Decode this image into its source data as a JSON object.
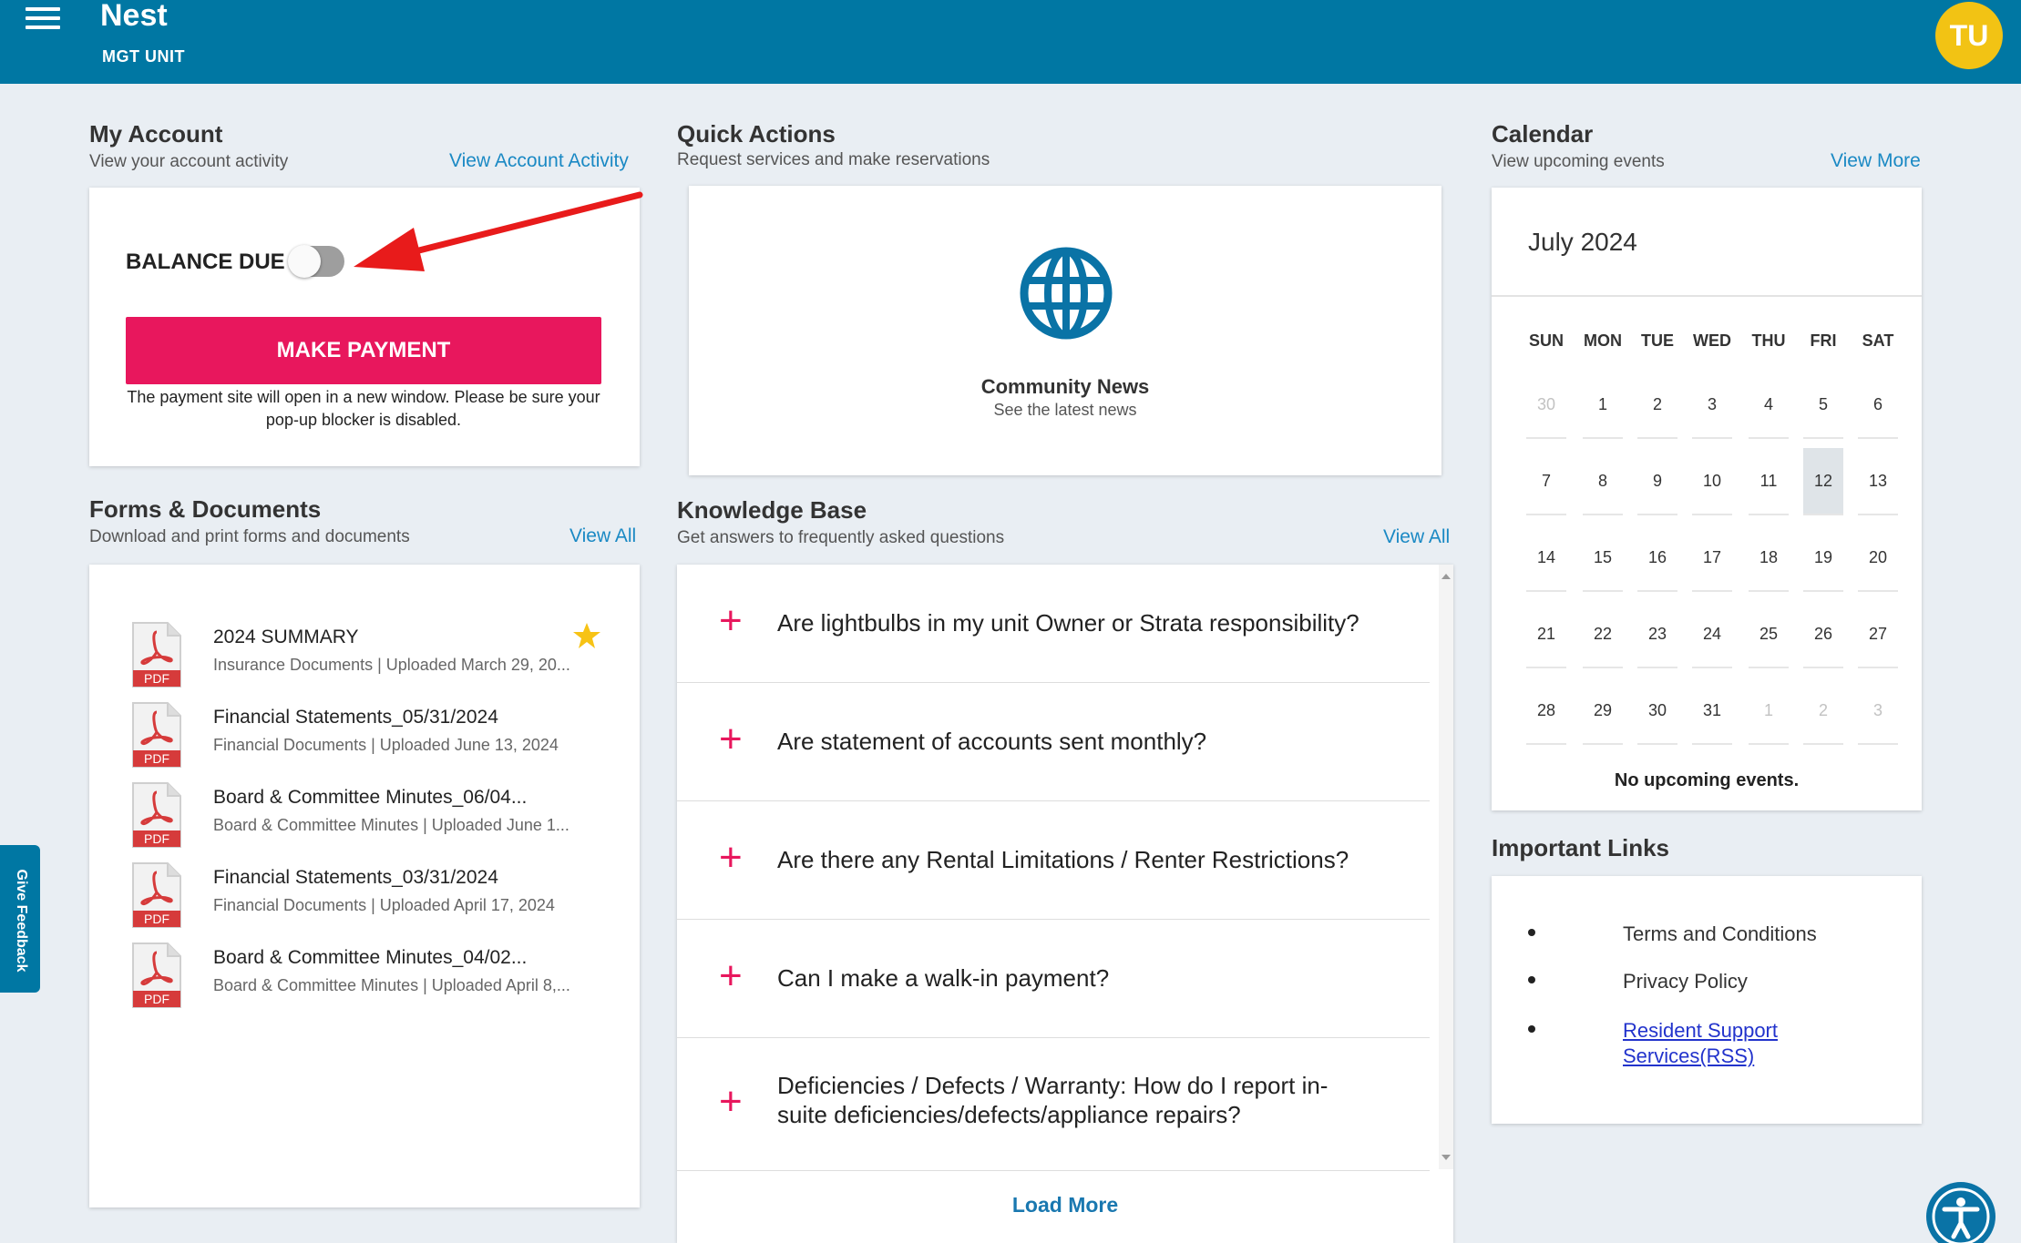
{
  "header": {
    "title": "Nest",
    "subtitle": "MGT UNIT",
    "avatar_initials": "TU",
    "bar_color": "#0077a3",
    "avatar_color": "#f2c314"
  },
  "account": {
    "title": "My Account",
    "subtitle": "View your account activity",
    "link": "View Account Activity",
    "balance_label": "BALANCE DUE",
    "toggle_on": false,
    "pay_button": "MAKE PAYMENT",
    "pay_note": "The payment site will open in a new window. Please be sure your pop-up blocker is disabled.",
    "accent": "#e8175d"
  },
  "quick_actions": {
    "title": "Quick Actions",
    "subtitle": "Request services and make reservations",
    "items": [
      {
        "icon": "globe-icon",
        "title": "Community News",
        "subtitle": "See the latest news"
      }
    ]
  },
  "forms": {
    "title": "Forms & Documents",
    "subtitle": "Download and print forms and documents",
    "link": "View All",
    "file_type": "PDF",
    "documents": [
      {
        "name": "2024 SUMMARY",
        "meta": "Insurance Documents | Uploaded March 29, 20...",
        "starred": true
      },
      {
        "name": "Financial Statements_05/31/2024",
        "meta": "Financial Documents | Uploaded June 13, 2024",
        "starred": false
      },
      {
        "name": "Board & Committee Minutes_06/04...",
        "meta": "Board & Committee Minutes | Uploaded June 1...",
        "starred": false
      },
      {
        "name": "Financial Statements_03/31/2024",
        "meta": "Financial Documents | Uploaded April 17, 2024",
        "starred": false
      },
      {
        "name": "Board & Committee Minutes_04/02...",
        "meta": "Board & Committee Minutes | Uploaded April 8,...",
        "starred": false
      }
    ]
  },
  "knowledge_base": {
    "title": "Knowledge Base",
    "subtitle": "Get answers to frequently asked questions",
    "link": "View All",
    "questions": [
      "Are lightbulbs in my unit Owner or Strata responsibility?",
      "Are statement of accounts sent monthly?",
      "Are there any Rental Limitations / Renter Restrictions?",
      "Can I make a walk-in payment?",
      "Deficiencies / Defects / Warranty: How do I report in-suite deficiencies/defects/appliance repairs?"
    ],
    "load_more": "Load More"
  },
  "calendar": {
    "title": "Calendar",
    "subtitle": "View upcoming events",
    "link": "View More",
    "month": "July 2024",
    "weekdays": [
      "SUN",
      "MON",
      "TUE",
      "WED",
      "THU",
      "FRI",
      "SAT"
    ],
    "weeks": [
      [
        {
          "d": "30",
          "m": true
        },
        {
          "d": "1"
        },
        {
          "d": "2"
        },
        {
          "d": "3"
        },
        {
          "d": "4"
        },
        {
          "d": "5"
        },
        {
          "d": "6"
        }
      ],
      [
        {
          "d": "7"
        },
        {
          "d": "8"
        },
        {
          "d": "9"
        },
        {
          "d": "10"
        },
        {
          "d": "11"
        },
        {
          "d": "12",
          "today": true
        },
        {
          "d": "13"
        }
      ],
      [
        {
          "d": "14"
        },
        {
          "d": "15"
        },
        {
          "d": "16"
        },
        {
          "d": "17"
        },
        {
          "d": "18"
        },
        {
          "d": "19"
        },
        {
          "d": "20"
        }
      ],
      [
        {
          "d": "21"
        },
        {
          "d": "22"
        },
        {
          "d": "23"
        },
        {
          "d": "24"
        },
        {
          "d": "25"
        },
        {
          "d": "26"
        },
        {
          "d": "27"
        }
      ],
      [
        {
          "d": "28"
        },
        {
          "d": "29"
        },
        {
          "d": "30"
        },
        {
          "d": "31"
        },
        {
          "d": "1",
          "m": true
        },
        {
          "d": "2",
          "m": true
        },
        {
          "d": "3",
          "m": true
        }
      ]
    ],
    "empty_text": "No upcoming events."
  },
  "important_links": {
    "title": "Important Links",
    "items": [
      {
        "label": "Terms and Conditions",
        "link": false
      },
      {
        "label": "Privacy Policy",
        "link": false
      },
      {
        "label": "Resident Support Services(RSS)",
        "link": true
      }
    ]
  },
  "feedback_tab": "Give Feedback",
  "accessibility_icon": "accessibility-icon"
}
